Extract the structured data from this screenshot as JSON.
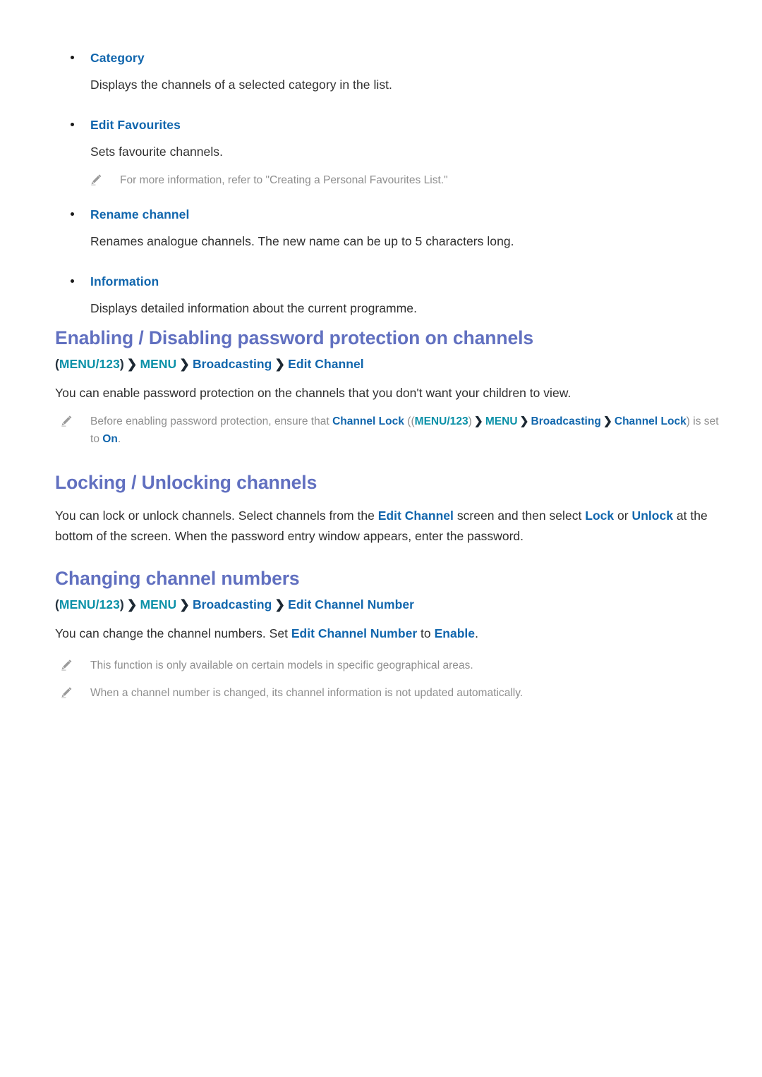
{
  "document": {
    "bullets": [
      {
        "label": "Category",
        "description": "Displays the channels of a selected category in the list."
      },
      {
        "label": "Edit Favourites",
        "description": "Sets favourite channels.",
        "note": "For more information, refer to \"Creating a Personal Favourites List.\""
      },
      {
        "label": "Rename channel",
        "description": "Renames analogue channels. The new name can be up to 5 characters long."
      },
      {
        "label": "Information",
        "description": "Displays detailed information about the current programme."
      }
    ],
    "sections": [
      {
        "heading": "Enabling / Disabling password protection on channels",
        "breadcrumb": {
          "open_paren": "(",
          "menu123": "MENU/123",
          "close_paren": ")",
          "arrow": "❯",
          "menu": "MENU",
          "broadcasting": "Broadcasting",
          "target": "Edit Channel"
        },
        "paragraph": "You can enable password protection on the channels that you don't want your children to view.",
        "note": {
          "lead": "Before enabling password protection, ensure that ",
          "channel_lock": "Channel Lock",
          "open": " ((",
          "menu123": "MENU/123",
          "close1": ")",
          "arrow": "❯",
          "menu": "MENU",
          "broadcasting": "Broadcasting",
          "channel_lock2": "Channel Lock",
          "mid": ") is set to ",
          "on": "On",
          "end": "."
        }
      },
      {
        "heading": "Locking / Unlocking channels",
        "paragraph_parts": {
          "p1": "You can lock or unlock channels. Select channels from the ",
          "edit_channel": "Edit Channel",
          "p2": " screen and then select ",
          "lock": "Lock",
          "p3": " or ",
          "unlock": "Unlock",
          "p4": " at the bottom of the screen. When the password entry window appears, enter the password."
        }
      },
      {
        "heading": "Changing channel numbers",
        "breadcrumb": {
          "open_paren": "(",
          "menu123": "MENU/123",
          "close_paren": ")",
          "arrow": "❯",
          "menu": "MENU",
          "broadcasting": "Broadcasting",
          "target": "Edit Channel Number"
        },
        "paragraph_parts": {
          "p1": "You can change the channel numbers. Set ",
          "edit_channel_number": "Edit Channel Number",
          "p2": " to ",
          "enable": "Enable",
          "p3": "."
        },
        "notes": [
          "This function is only available on certain models in specific geographical areas.",
          "When a channel number is changed, its channel information is not updated automatically."
        ]
      }
    ]
  },
  "colors": {
    "heading": "#6170c0",
    "link_blue": "#1166ad",
    "teal": "#0b91a8",
    "body": "#2f2f2f",
    "note_gray": "#8e8e8e",
    "background": "#ffffff"
  }
}
